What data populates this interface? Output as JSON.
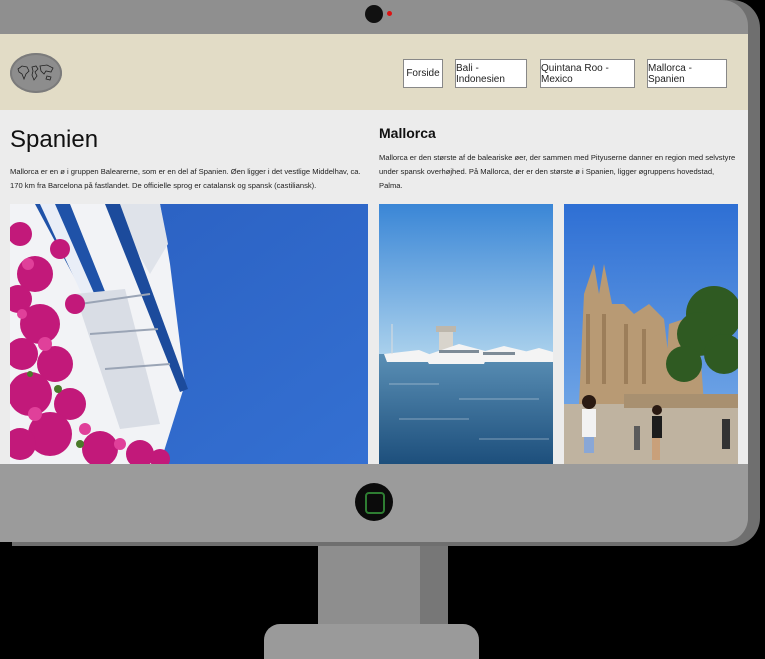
{
  "nav": {
    "items": [
      {
        "label": "Forside"
      },
      {
        "label": "Bali - Indonesien"
      },
      {
        "label": "Quintana Roo - Mexico"
      },
      {
        "label": "Mallorca - Spanien"
      }
    ]
  },
  "left": {
    "title": "Spanien",
    "text": "Mallorca er en ø i gruppen Balearerne, som er en del af Spanien. Øen ligger i det vestlige Middelhav, ca. 170 km fra Barcelona på fastlandet. De officielle sprog er catalansk og spansk (castiliansk)."
  },
  "right": {
    "title": "Mallorca",
    "text": "Mallorca er den største af de baleariske øer, der sammen med Pityuserne danner en region med selvstyre under spansk overhøjhed. På Mallorca, der er den største ø i Spanien, ligger øgruppens hovedstad, Palma."
  },
  "icons": {
    "logo": "world-map-icon",
    "camera": "webcam-icon",
    "home": "home-button-icon"
  },
  "colors": {
    "header_bg": "#e2dcc6",
    "page_bg": "#ececec",
    "frame": "#8f8f8f",
    "sky_blue": "#2a63c4"
  }
}
